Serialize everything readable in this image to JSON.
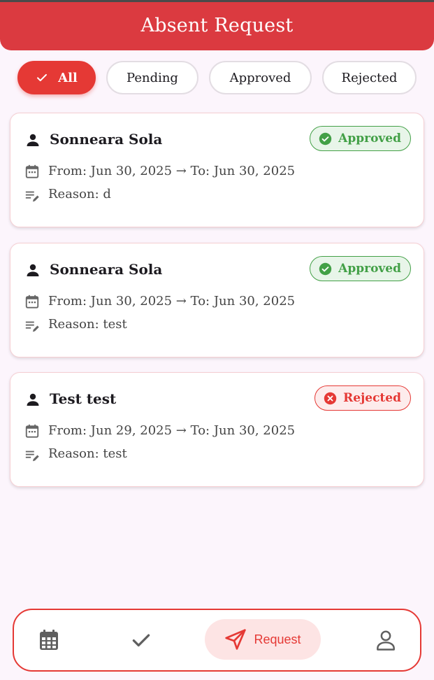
{
  "header": {
    "title": "Absent Request"
  },
  "filters": [
    {
      "label": "All",
      "selected": true
    },
    {
      "label": "Pending",
      "selected": false
    },
    {
      "label": "Approved",
      "selected": false
    },
    {
      "label": "Rejected",
      "selected": false
    }
  ],
  "requests": [
    {
      "name": "Sonneara Sola",
      "status": "Approved",
      "dates": "From: Jun 30, 2025 → To: Jun 30, 2025",
      "reason": "Reason: d"
    },
    {
      "name": "Sonneara Sola",
      "status": "Approved",
      "dates": "From: Jun 30, 2025 → To: Jun 30, 2025",
      "reason": "Reason: test"
    },
    {
      "name": "Test test",
      "status": "Rejected",
      "dates": "From: Jun 29, 2025 → To: Jun 30, 2025",
      "reason": "Reason: test"
    }
  ],
  "bottom_nav": {
    "items": [
      {
        "icon": "calendar-icon"
      },
      {
        "icon": "check-icon"
      },
      {
        "icon": "send-icon",
        "label": "Request",
        "active": true
      },
      {
        "icon": "profile-icon"
      }
    ]
  },
  "colors": {
    "primary": "#e53935",
    "header": "#db3a40",
    "approved": "#43a047",
    "rejected": "#e53935"
  }
}
